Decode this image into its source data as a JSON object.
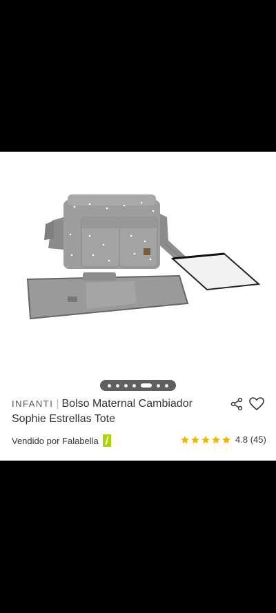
{
  "product": {
    "brand": "INFANTI",
    "separator": "|",
    "title": "Bolso Maternal Cambiador Sophie Estrellas Tote",
    "seller_prefix": "Vendido por",
    "seller_name": "Falabella",
    "rating_value": "4.8",
    "rating_count": "(45)",
    "rating_stars": 5
  },
  "carousel": {
    "total_slides": 7,
    "active_index": 4
  },
  "icons": {
    "share": "share-icon",
    "favorite": "heart-icon",
    "seller_badge": "falabella-badge-icon",
    "star": "star-icon"
  },
  "colors": {
    "star": "#f5b400",
    "seller_badge": "#aad500",
    "dots_bg": "#5f5f5f"
  }
}
